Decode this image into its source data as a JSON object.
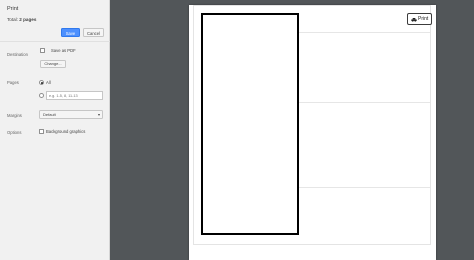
{
  "print_panel": {
    "title": "Print",
    "total_prefix": "Total: ",
    "total_value": "2 pages",
    "save_label": "Save",
    "cancel_label": "Cancel",
    "destination": {
      "label": "Destination",
      "option_label": "Save as PDF",
      "change_label": "Change..."
    },
    "pages": {
      "label": "Pages",
      "all_label": "All",
      "range_placeholder": "e.g. 1-5, 8, 11-13"
    },
    "margins": {
      "label": "Margins",
      "selected": "Default"
    },
    "options": {
      "label": "Options",
      "background_graphics_label": "Background graphics"
    }
  },
  "preview": {
    "print_button_label": "Print"
  },
  "icons": {
    "print_button": "printer-icon",
    "margins_select": "chevron-down-icon"
  },
  "colors": {
    "save_button": "#4d90fe",
    "preview_background": "#525659"
  }
}
